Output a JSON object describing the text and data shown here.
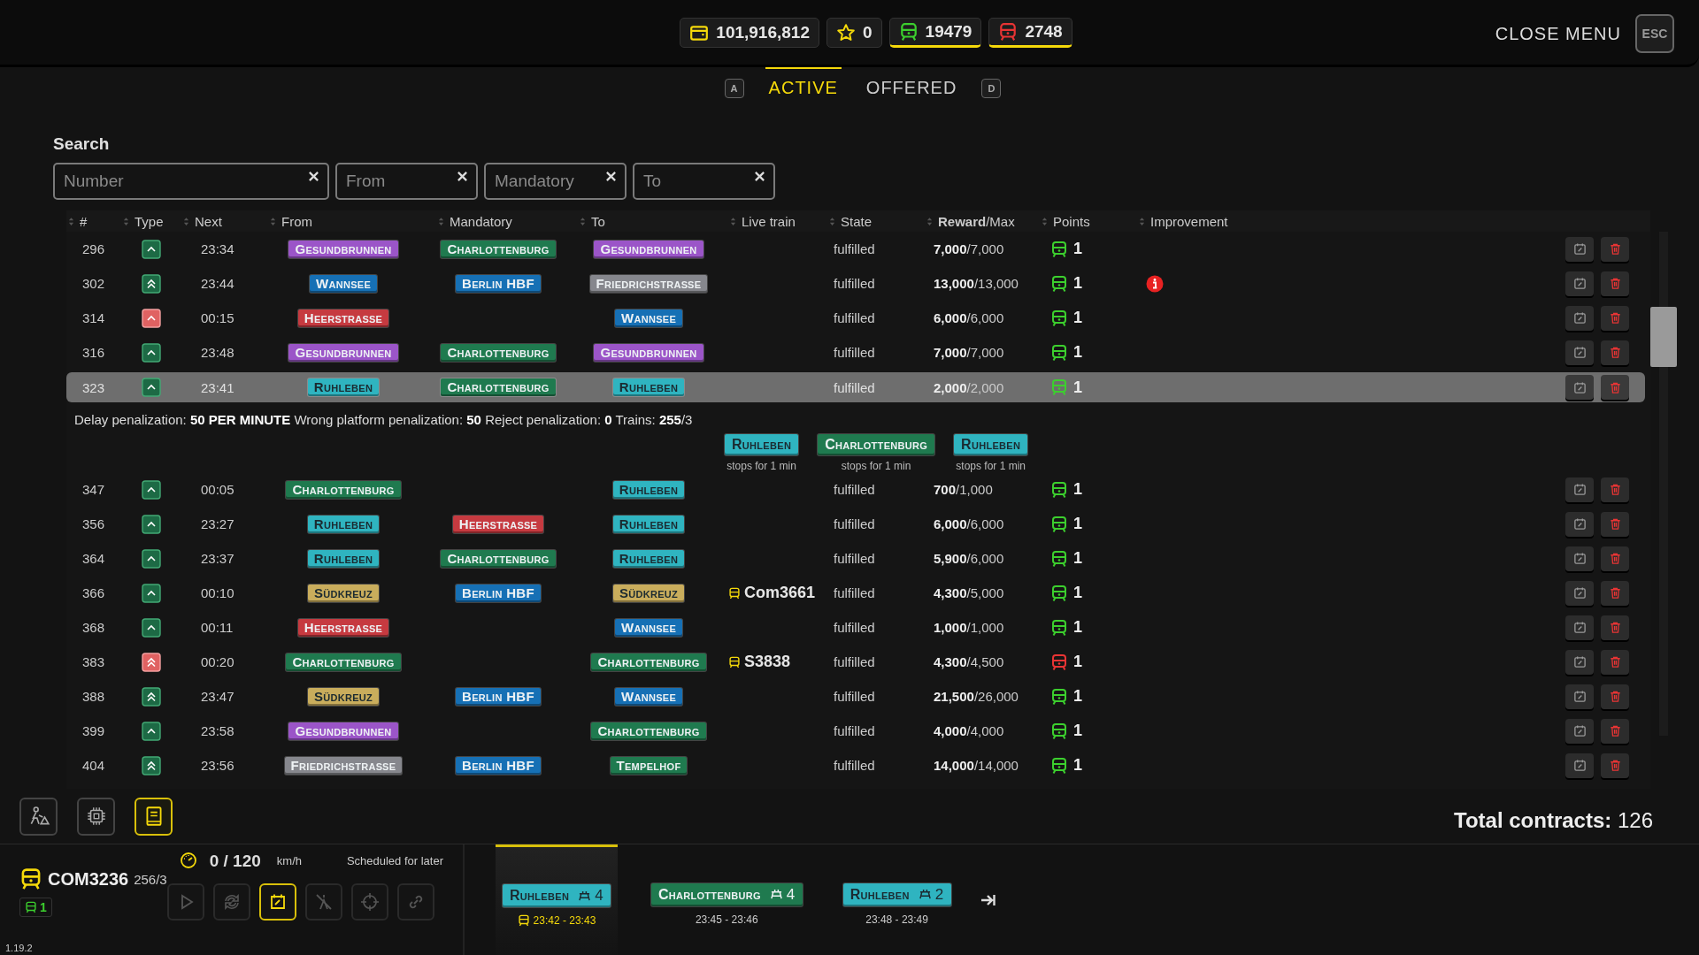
{
  "top_bar": {
    "resources": [
      {
        "kind": "wallet",
        "value": "101,916,812",
        "highlighted": false
      },
      {
        "kind": "star",
        "value": "0",
        "highlighted": false
      },
      {
        "kind": "train",
        "value": "19479",
        "highlighted": true,
        "color": "#3ccf2e"
      },
      {
        "kind": "train",
        "value": "2748",
        "highlighted": true,
        "color": "#e83434"
      }
    ],
    "close_label": "CLOSE MENU",
    "close_key": "ESC"
  },
  "tabs": {
    "prev_key": "A",
    "next_key": "D",
    "items": [
      {
        "label": "ACTIVE",
        "selected": true
      },
      {
        "label": "OFFERED",
        "selected": false
      }
    ]
  },
  "search": {
    "title": "Search",
    "fields": [
      {
        "placeholder": "Number"
      },
      {
        "placeholder": "From"
      },
      {
        "placeholder": "Mandatory"
      },
      {
        "placeholder": "To"
      }
    ]
  },
  "columns": [
    "#",
    "Type",
    "Next",
    "From",
    "Mandatory",
    "To",
    "Live train",
    "State",
    "**Reward**/Max",
    "Points",
    "Improvement"
  ],
  "rows": [
    {
      "number": "296",
      "type": {
        "kind": "single",
        "alert": false
      },
      "next": "23:34",
      "from": {
        "name": "Gesundbrunnen",
        "color": "#9b55c8"
      },
      "mandatory": {
        "name": "Charlottenburg",
        "color": "#1f7a4f"
      },
      "to": {
        "name": "Gesundbrunnen",
        "color": "#9b55c8"
      },
      "state": "fulfilled",
      "reward": "**7,000**/7,000",
      "points": "1",
      "points_alert": false,
      "improvement_notice": false,
      "selected": false
    },
    {
      "number": "302",
      "type": {
        "kind": "double",
        "alert": false
      },
      "next": "23:44",
      "from": {
        "name": "Wannsee",
        "color": "#1670b5"
      },
      "mandatory": {
        "name": "Berlin HBF",
        "color": "#1670b5"
      },
      "to": {
        "name": "Friedrichstraße",
        "color": "#86878d"
      },
      "state": "fulfilled",
      "reward": "**13,000**/13,000",
      "points": "1",
      "points_alert": false,
      "improvement_notice": true,
      "selected": false
    },
    {
      "number": "314",
      "type": {
        "kind": "single",
        "alert": true
      },
      "next": "00:15",
      "from": {
        "name": "Heerstraße",
        "color": "#c63a40"
      },
      "to": {
        "name": "Wannsee",
        "color": "#1670b5"
      },
      "state": "fulfilled",
      "reward": "**6,000**/6,000",
      "points": "1",
      "points_alert": false,
      "improvement_notice": false,
      "selected": false
    },
    {
      "number": "316",
      "type": {
        "kind": "single",
        "alert": false
      },
      "next": "23:48",
      "from": {
        "name": "Gesundbrunnen",
        "color": "#9b55c8"
      },
      "mandatory": {
        "name": "Charlottenburg",
        "color": "#1f7a4f"
      },
      "to": {
        "name": "Gesundbrunnen",
        "color": "#9b55c8"
      },
      "state": "fulfilled",
      "reward": "**7,000**/7,000",
      "points": "1",
      "points_alert": false,
      "improvement_notice": false,
      "selected": false
    },
    {
      "number": "323",
      "type": {
        "kind": "single",
        "alert": false
      },
      "next": "23:41",
      "from": {
        "name": "Ruhleben",
        "color": "#2fb4c0"
      },
      "mandatory": {
        "name": "Charlottenburg",
        "color": "#1f7a4f"
      },
      "to": {
        "name": "Ruhleben",
        "color": "#2fb4c0"
      },
      "state": "fulfilled",
      "reward": "**2,000**/2,000",
      "points": "1",
      "points_alert": false,
      "improvement_notice": false,
      "selected": true,
      "details": {
        "text": "Delay penalization: **50 PER MINUTE** Wrong platform penalization: **50** Reject penalization: **0** Trains: **255**/3",
        "stops": [
          {
            "name": "Ruhleben",
            "color": "#2fb4c0",
            "note": "stops for 1 min"
          },
          {
            "name": "Charlottenburg",
            "color": "#1f7a4f",
            "note": "stops for 1 min"
          },
          {
            "name": "Ruhleben",
            "color": "#2fb4c0",
            "note": "stops for 1 min"
          }
        ]
      }
    },
    {
      "number": "347",
      "type": {
        "kind": "single",
        "alert": false
      },
      "next": "00:05",
      "from": {
        "name": "Charlottenburg",
        "color": "#1f7a4f"
      },
      "to": {
        "name": "Ruhleben",
        "color": "#2fb4c0"
      },
      "state": "fulfilled",
      "reward": "**700**/1,000",
      "points": "1",
      "points_alert": false,
      "improvement_notice": false,
      "selected": false
    },
    {
      "number": "356",
      "type": {
        "kind": "single",
        "alert": false
      },
      "next": "23:27",
      "from": {
        "name": "Ruhleben",
        "color": "#2fb4c0"
      },
      "mandatory": {
        "name": "Heerstraße",
        "color": "#c63a40"
      },
      "to": {
        "name": "Ruhleben",
        "color": "#2fb4c0"
      },
      "state": "fulfilled",
      "reward": "**6,000**/6,000",
      "points": "1",
      "points_alert": false,
      "improvement_notice": false,
      "selected": false
    },
    {
      "number": "364",
      "type": {
        "kind": "single",
        "alert": false
      },
      "next": "23:37",
      "from": {
        "name": "Ruhleben",
        "color": "#2fb4c0"
      },
      "mandatory": {
        "name": "Charlottenburg",
        "color": "#1f7a4f"
      },
      "to": {
        "name": "Ruhleben",
        "color": "#2fb4c0"
      },
      "state": "fulfilled",
      "reward": "**5,900**/6,000",
      "points": "1",
      "points_alert": false,
      "improvement_notice": false,
      "selected": false
    },
    {
      "number": "366",
      "type": {
        "kind": "single",
        "alert": false
      },
      "next": "00:10",
      "from": {
        "name": "Südkreuz",
        "color": "#c9ad5c"
      },
      "mandatory": {
        "name": "Berlin HBF",
        "color": "#1670b5"
      },
      "to": {
        "name": "Südkreuz",
        "color": "#c9ad5c"
      },
      "live_train": "Com3661",
      "state": "fulfilled",
      "reward": "**4,300**/5,000",
      "points": "1",
      "points_alert": false,
      "improvement_notice": false,
      "selected": false
    },
    {
      "number": "368",
      "type": {
        "kind": "single",
        "alert": false
      },
      "next": "00:11",
      "from": {
        "name": "Heerstraße",
        "color": "#c63a40"
      },
      "to": {
        "name": "Wannsee",
        "color": "#1670b5"
      },
      "state": "fulfilled",
      "reward": "**1,000**/1,000",
      "points": "1",
      "points_alert": false,
      "improvement_notice": false,
      "selected": false
    },
    {
      "number": "383",
      "type": {
        "kind": "double",
        "alert": true
      },
      "next": "00:20",
      "from": {
        "name": "Charlottenburg",
        "color": "#1f7a4f"
      },
      "to": {
        "name": "Charlottenburg",
        "color": "#1f7a4f"
      },
      "live_train": "S3838",
      "state": "fulfilled",
      "reward": "**4,300**/4,500",
      "points": "1",
      "points_alert": true,
      "improvement_notice": false,
      "selected": false
    },
    {
      "number": "388",
      "type": {
        "kind": "double",
        "alert": false
      },
      "next": "23:47",
      "from": {
        "name": "Südkreuz",
        "color": "#c9ad5c"
      },
      "mandatory": {
        "name": "Berlin HBF",
        "color": "#1670b5"
      },
      "to": {
        "name": "Wannsee",
        "color": "#1670b5"
      },
      "state": "fulfilled",
      "reward": "**21,500**/26,000",
      "points": "1",
      "points_alert": false,
      "improvement_notice": false,
      "selected": false
    },
    {
      "number": "399",
      "type": {
        "kind": "single",
        "alert": false
      },
      "next": "23:58",
      "from": {
        "name": "Gesundbrunnen",
        "color": "#9b55c8"
      },
      "to": {
        "name": "Charlottenburg",
        "color": "#1f7a4f"
      },
      "state": "fulfilled",
      "reward": "**4,000**/4,000",
      "points": "1",
      "points_alert": false,
      "improvement_notice": false,
      "selected": false
    },
    {
      "number": "404",
      "type": {
        "kind": "double",
        "alert": false
      },
      "next": "23:56",
      "from": {
        "name": "Friedrichstraße",
        "color": "#86878d"
      },
      "mandatory": {
        "name": "Berlin HBF",
        "color": "#1670b5"
      },
      "to": {
        "name": "Tempelhof",
        "color": "#1f7a4f"
      },
      "state": "fulfilled",
      "reward": "**14,000**/14,000",
      "points": "1",
      "points_alert": false,
      "improvement_notice": false,
      "selected": false
    }
  ],
  "tools": [
    {
      "kind": "construction",
      "selected": false
    },
    {
      "kind": "chip",
      "selected": false
    },
    {
      "kind": "book",
      "selected": true
    }
  ],
  "total": "**Total contracts:** 126",
  "train": {
    "name": "COM3236",
    "capacity": "256/3",
    "count": "1",
    "speed": "0 / 120",
    "unit": "km/h",
    "status": "Scheduled for later",
    "version": "1.19.2",
    "controls": [
      {
        "kind": "play",
        "selected": false
      },
      {
        "kind": "refresh",
        "selected": false
      },
      {
        "kind": "calendar",
        "selected": true
      },
      {
        "kind": "no-signal",
        "selected": false
      },
      {
        "kind": "target",
        "selected": false
      },
      {
        "kind": "link",
        "selected": false
      }
    ],
    "stops": [
      {
        "name": "Ruhleben",
        "color": "#2fb4c0",
        "platform": "4",
        "time": "23:42 - 23:43",
        "current": true
      },
      {
        "name": "Charlottenburg",
        "color": "#1f7a4f",
        "platform": "4",
        "time": "23:45 - 23:46",
        "current": false
      },
      {
        "name": "Ruhleben",
        "color": "#2fb4c0",
        "platform": "2",
        "time": "23:48 - 23:49",
        "current": false
      }
    ]
  }
}
